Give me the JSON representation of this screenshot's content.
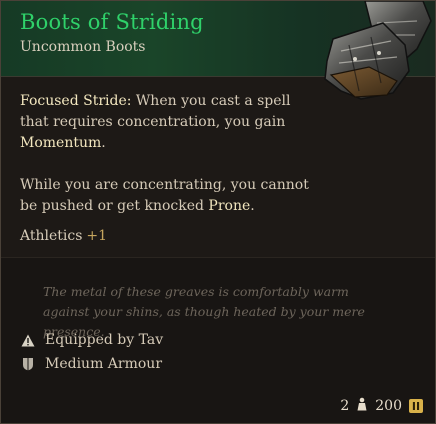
{
  "item": {
    "name": "Boots of Striding",
    "type": "Uncommon Boots"
  },
  "effect": {
    "name": "Focused Stride:",
    "text_before": " When you cast a spell that requires concentration, you gain ",
    "keyword": "Momentum",
    "text_after": "."
  },
  "effect2": {
    "text_before": "While you are concentrating, you cannot be pushed or get knocked ",
    "keyword": "Prone",
    "text_after": "."
  },
  "bonus": {
    "label": "Athletics",
    "value": "+1"
  },
  "flavor": "The metal of these greaves is comfortably warm against your shins, as though heated by your mere presence.",
  "equipped": "Equipped by Tav",
  "armour": "Medium Armour",
  "footer": {
    "weight": "2",
    "value": "200"
  },
  "colors": {
    "rarity": "#2fd16a",
    "keyword": "#f3e7bf",
    "bonus": "#c5a55e"
  },
  "icons": {
    "equipped": "warning-triangle-icon",
    "armour": "armour-shield-icon",
    "weight": "weight-icon",
    "gold": "gold-coin-icon"
  }
}
